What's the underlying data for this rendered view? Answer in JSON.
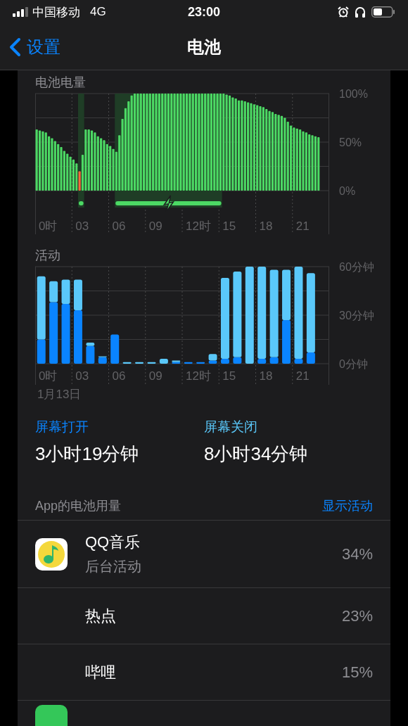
{
  "status_bar": {
    "carrier": "中国移动",
    "network": "4G",
    "time": "23:00"
  },
  "nav": {
    "back": "设置",
    "title": "电池"
  },
  "battery_level": {
    "time_labels": [
      "0时",
      "03",
      "06",
      "09",
      "12时",
      "15",
      "18",
      "21"
    ],
    "chart_data": {
      "type": "bar",
      "stacked": true,
      "grid": true,
      "ylim": [
        0,
        100
      ],
      "yticks": [
        {
          "value": 0,
          "label": "0%"
        },
        {
          "value": 50,
          "label": "50%"
        },
        {
          "value": 100,
          "label": "100%"
        }
      ],
      "series": [
        {
          "name": "电池电量",
          "color": "#4cd964",
          "values": [
            63,
            62,
            61,
            60,
            56,
            54,
            51,
            48,
            45,
            41,
            38,
            35,
            32,
            28,
            null,
            37,
            63,
            63,
            62,
            60,
            56,
            54,
            52,
            48,
            46,
            43,
            40,
            57,
            74,
            85,
            92,
            98,
            100,
            100,
            100,
            100,
            100,
            100,
            100,
            100,
            100,
            100,
            100,
            100,
            100,
            100,
            100,
            100,
            100,
            100,
            100,
            100,
            100,
            100,
            100,
            100,
            100,
            100,
            100,
            100,
            100,
            100,
            99,
            98,
            96,
            95,
            93,
            93,
            92,
            91,
            90,
            89,
            88,
            87,
            86,
            84,
            82,
            81,
            79,
            78,
            77,
            75,
            71,
            67,
            65,
            64,
            63,
            61,
            60,
            58,
            57,
            56,
            55
          ]
        },
        {
          "color": "#ff6a3d",
          "values": [
            null,
            null,
            null,
            null,
            null,
            null,
            null,
            null,
            null,
            null,
            null,
            null,
            null,
            null,
            20,
            null,
            null,
            null,
            null,
            null,
            null,
            null,
            null,
            null,
            null,
            null,
            null,
            null,
            null,
            null,
            null,
            null,
            null,
            null,
            null,
            null,
            null,
            null,
            null,
            null,
            null,
            null,
            null,
            null,
            null,
            null,
            null,
            null,
            null,
            null,
            null,
            null,
            null,
            null,
            null,
            null,
            null,
            null,
            null,
            null,
            null,
            null,
            null,
            null,
            null,
            null,
            null,
            null,
            null,
            null,
            null,
            null,
            null,
            null,
            null,
            null,
            null,
            null,
            null,
            null,
            null,
            null,
            null,
            null,
            null,
            null,
            null,
            null,
            null,
            null,
            null,
            null,
            null
          ]
        }
      ]
    }
  },
  "activity": {
    "title": "活动",
    "time_labels": [
      "0时",
      "03",
      "06",
      "09",
      "12时",
      "15",
      "18",
      "21"
    ],
    "date": "1月13日",
    "chart_data": {
      "type": "bar",
      "stacked": true,
      "grid": true,
      "ylim": [
        0,
        60
      ],
      "yticks": [
        {
          "value": 0,
          "label": "0分钟"
        },
        {
          "value": 30,
          "label": "30分钟"
        },
        {
          "value": 60,
          "label": "60分钟"
        }
      ],
      "series": [
        {
          "name": "屏幕打开",
          "color": "#0a84ff",
          "values": [
            15,
            38,
            37,
            33,
            11,
            4,
            18,
            0,
            0,
            0,
            0,
            1,
            1,
            1,
            2,
            3,
            4,
            0,
            3,
            4,
            27,
            3,
            7
          ]
        },
        {
          "name": "屏幕关闭",
          "color": "#5ac8fa",
          "values": [
            39,
            13,
            15,
            19,
            2,
            0.6,
            0,
            1,
            1,
            1,
            3,
            1,
            0,
            0,
            4,
            50,
            53,
            60,
            57,
            54,
            31,
            57,
            49
          ]
        }
      ]
    }
  },
  "summary": [
    {
      "value": "3小时19分钟"
    },
    {
      "value": "8小时34分钟"
    }
  ],
  "app_usage": {
    "title": "App的电池用量",
    "action": "显示活动",
    "apps": [
      {
        "kind": "music",
        "name": "QQ音乐",
        "detail": "后台活动",
        "percent": "34%"
      },
      {
        "kind": "hidden",
        "name": "热点",
        "percent": "23%"
      },
      {
        "kind": "hidden",
        "name": "哔哩",
        "percent": "15%"
      },
      {
        "kind": "green"
      }
    ]
  }
}
